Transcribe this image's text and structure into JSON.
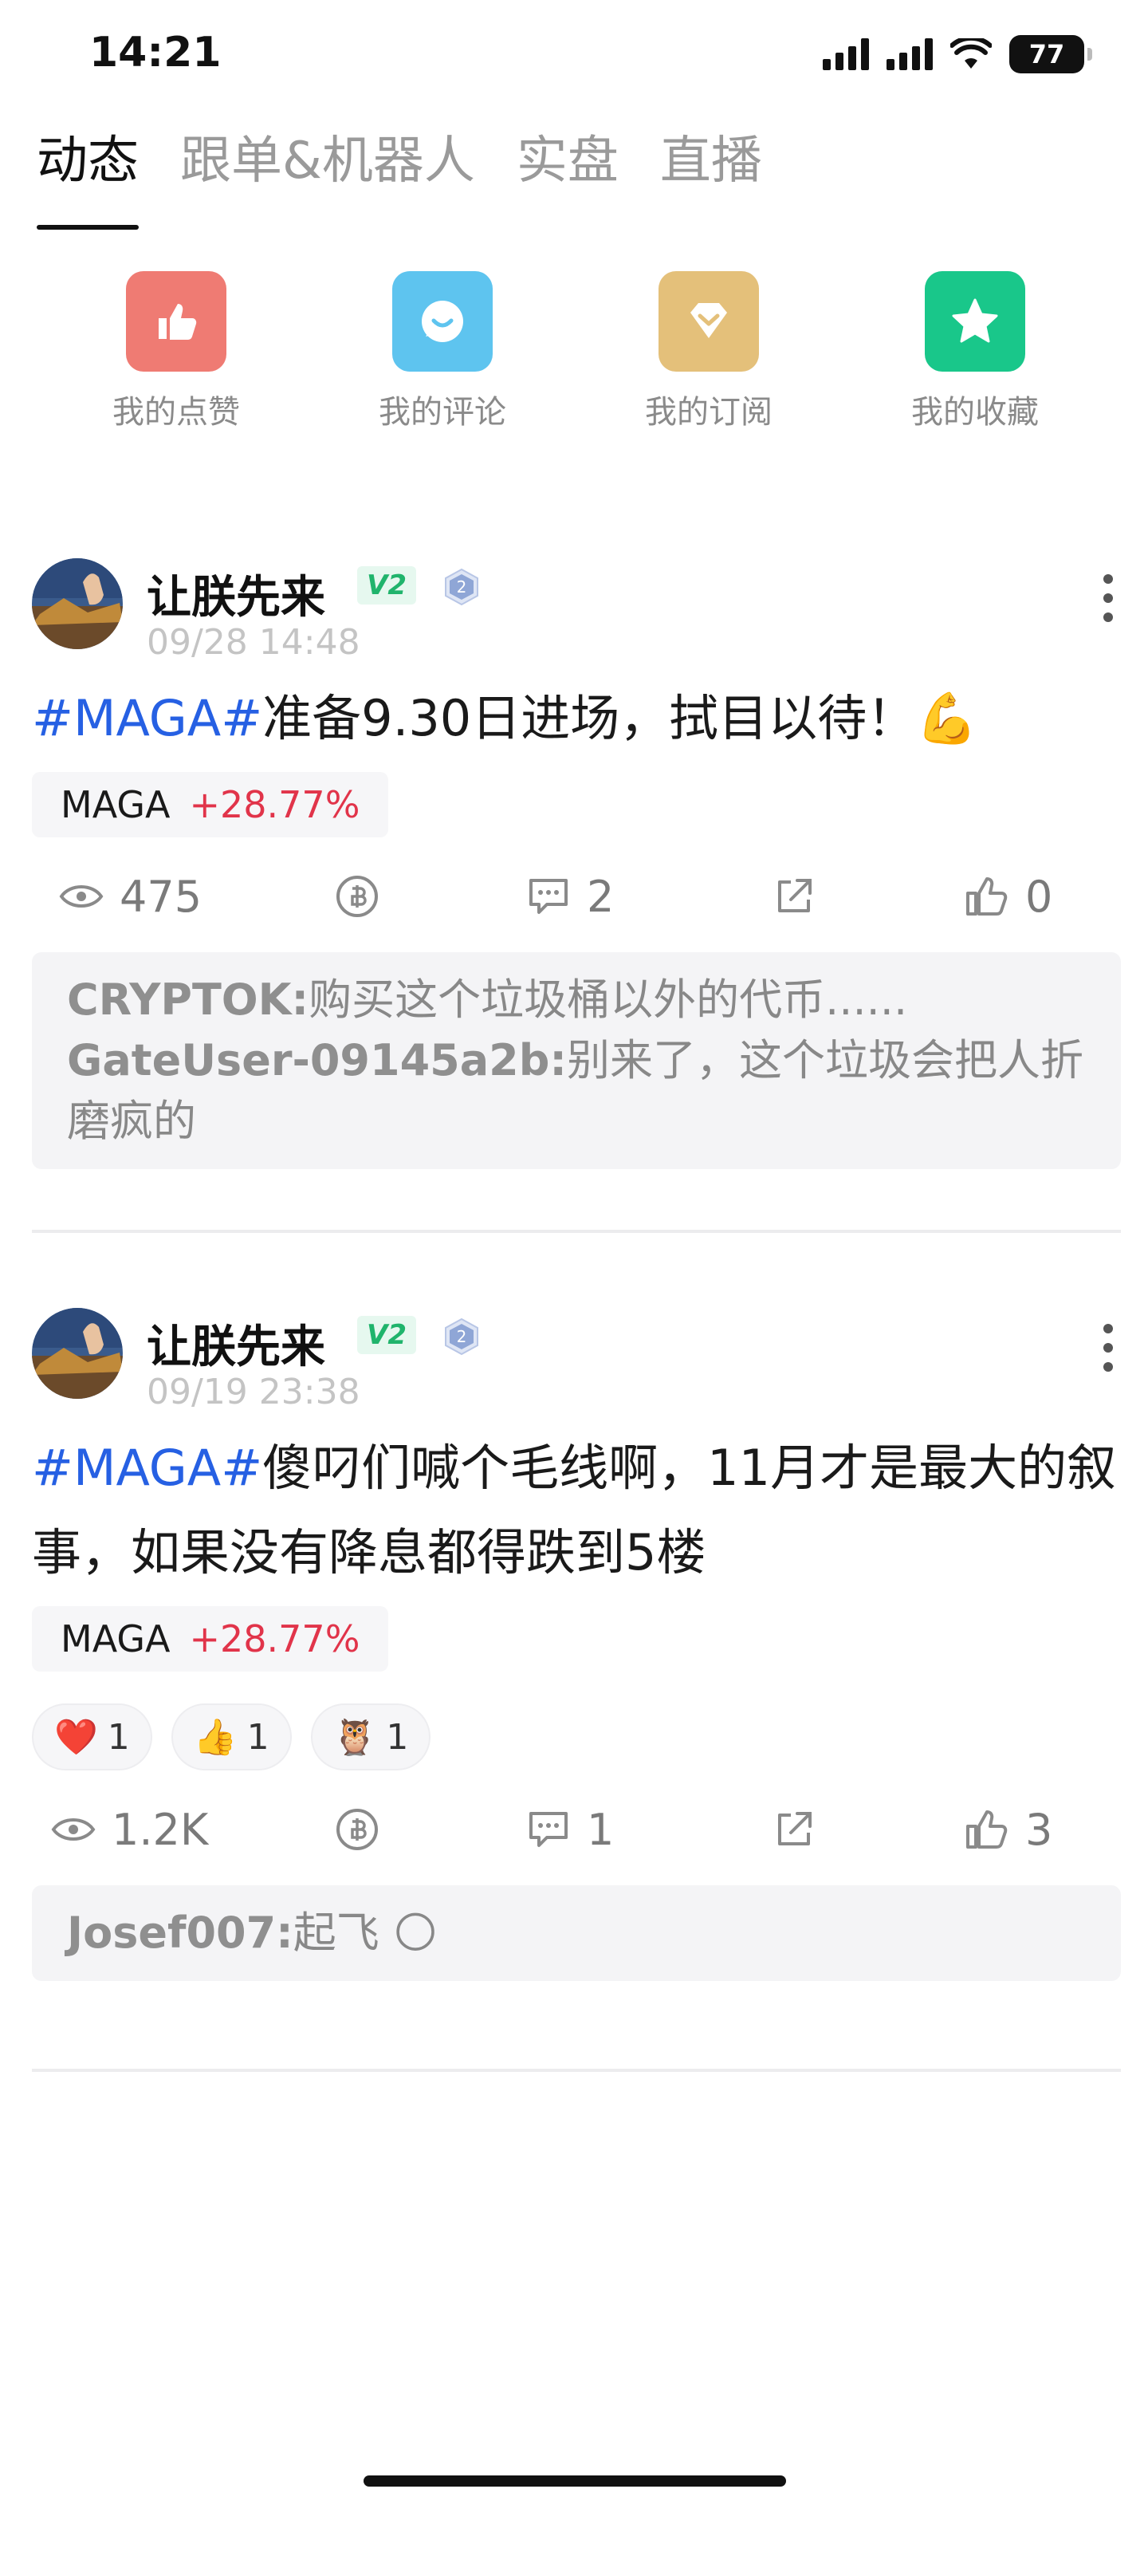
{
  "status_bar": {
    "time": "14:21",
    "battery": "77"
  },
  "tabs": [
    {
      "label": "动态",
      "active": true
    },
    {
      "label": "跟单&机器人",
      "active": false
    },
    {
      "label": "实盘",
      "active": false
    },
    {
      "label": "直播",
      "active": false
    }
  ],
  "quick_actions": [
    {
      "label": "我的点赞",
      "icon": "thumbs-up-icon",
      "color": "#ef7b73"
    },
    {
      "label": "我的评论",
      "icon": "comment-icon",
      "color": "#5ec4ef"
    },
    {
      "label": "我的订阅",
      "icon": "subscribe-icon",
      "color": "#e4c07a"
    },
    {
      "label": "我的收藏",
      "icon": "star-icon",
      "color": "#19c78a"
    }
  ],
  "posts": [
    {
      "author": "让朕先来",
      "badge": "V2",
      "level": "2",
      "time": "09/28 14:48",
      "hashtag": "#MAGA#",
      "text": "准备9.30日进场，拭目以待！💪",
      "coin": {
        "symbol": "MAGA",
        "change": "+28.77%"
      },
      "views": "475",
      "comments_count": "2",
      "likes": "0",
      "comments": [
        {
          "user": "CRYPTOK:",
          "text": "购买这个垃圾桶以外的代币......"
        },
        {
          "user": "GateUser-09145a2b:",
          "text": "别来了，这个垃圾会把人折磨疯的"
        }
      ]
    },
    {
      "author": "让朕先来",
      "badge": "V2",
      "level": "2",
      "time": "09/19 23:38",
      "hashtag": "#MAGA#",
      "text": "傻叼们喊个毛线啊，11月才是最大的叙事，如果没有降息都得跌到5楼",
      "coin": {
        "symbol": "MAGA",
        "change": "+28.77%"
      },
      "reactions": [
        {
          "emoji": "❤️",
          "count": "1",
          "icon": "heart-icon"
        },
        {
          "emoji": "👍",
          "count": "1",
          "icon": "thumbs-up-emoji-icon"
        },
        {
          "emoji": "🦉",
          "count": "1",
          "icon": "hodl-owl-icon"
        }
      ],
      "views": "1.2K",
      "comments_count": "1",
      "likes": "3",
      "comments": [
        {
          "user": "Josef007:",
          "text": "起飞 🌕"
        }
      ]
    }
  ]
}
